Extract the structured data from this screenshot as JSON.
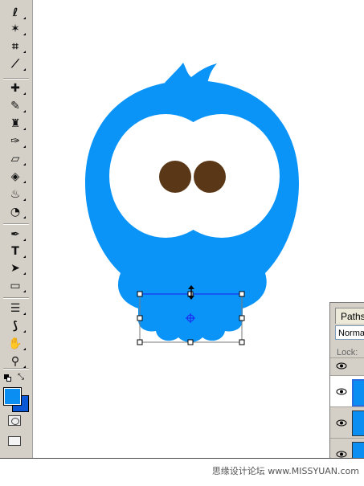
{
  "toolbox": {
    "tools": [
      {
        "name": "lasso-tool",
        "glyph": "ℓ"
      },
      {
        "name": "magic-wand-tool",
        "glyph": "✶"
      },
      {
        "name": "crop-tool",
        "glyph": "⌗"
      },
      {
        "name": "slice-tool",
        "glyph": "⟋"
      },
      {
        "name": "healing-brush-tool",
        "glyph": "✚"
      },
      {
        "name": "brush-tool",
        "glyph": "✎"
      },
      {
        "name": "clone-stamp-tool",
        "glyph": "♜"
      },
      {
        "name": "history-brush-tool",
        "glyph": "✑"
      },
      {
        "name": "eraser-tool",
        "glyph": "▱"
      },
      {
        "name": "paint-bucket-tool",
        "glyph": "◈"
      },
      {
        "name": "blur-tool",
        "glyph": "♨"
      },
      {
        "name": "dodge-tool",
        "glyph": "◔"
      },
      {
        "name": "pen-tool",
        "glyph": "✒"
      },
      {
        "name": "type-tool",
        "glyph": "T"
      },
      {
        "name": "path-selection-tool",
        "glyph": "➤"
      },
      {
        "name": "rectangle-tool",
        "glyph": "▭"
      },
      {
        "name": "notes-tool",
        "glyph": "☰"
      },
      {
        "name": "eyedropper-tool",
        "glyph": "⟆"
      },
      {
        "name": "hand-tool",
        "glyph": "✋"
      },
      {
        "name": "zoom-tool",
        "glyph": "⚲"
      }
    ],
    "foreground_color": "#0a8ef2",
    "background_color": "#0a58d8"
  },
  "paths_panel": {
    "tab_label": "Paths",
    "blend_mode": "Normal",
    "lock_label": "Lock:"
  },
  "canvas": {
    "bird_color": "#0a94f8",
    "eye_color": "#ffffff",
    "pupil_color": "#5a3716",
    "selection_color": "#1e1ef0"
  },
  "watermark": "思缘设计论坛 www.MISSYUAN.com"
}
